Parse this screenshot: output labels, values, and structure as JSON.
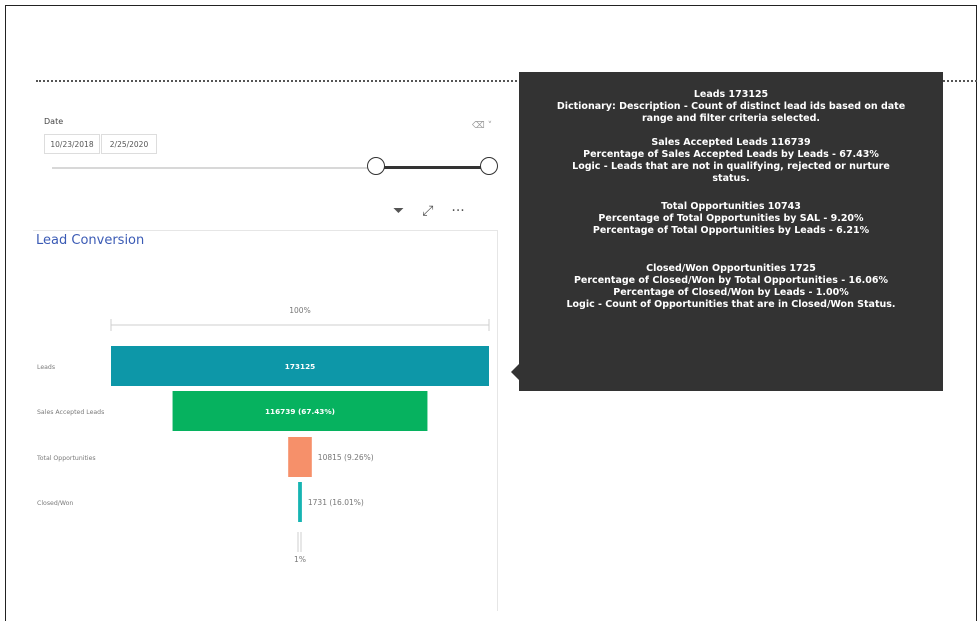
{
  "filter": {
    "label": "Date",
    "start": "10/23/2018",
    "end": "2/25/2020"
  },
  "chart_data": {
    "type": "bar",
    "title": "Lead Conversion",
    "categories": [
      "Leads",
      "Sales Accepted Leads",
      "Total Opportunities",
      "Closed/Won"
    ],
    "values": [
      173125,
      116739,
      10815,
      1731
    ],
    "labels": [
      "173125",
      "116739 (67.43%)",
      "10815 (9.26%)",
      "1731 (16.01%)"
    ],
    "colors": [
      "#0d97a8",
      "#06b25f",
      "#f6906a",
      "#16b4b2"
    ],
    "top_percent": "100%",
    "bottom_percent": "1%"
  },
  "tooltip": {
    "leads_title": "Leads 173125",
    "leads_desc": "Dictionary: Description - Count of distinct lead ids based on date\nrange and filter criteria selected.",
    "sal_title": "Sales Accepted Leads 116739",
    "sal_pct": "Percentage of Sales Accepted Leads by Leads - 67.43%",
    "sal_logic": "Logic -  Leads that are not in qualifying, rejected or nurture\nstatus.",
    "opp_title": "Total Opportunities 10743",
    "opp_sal": "Percentage of Total Opportunities by SAL - 9.20%",
    "opp_leads": "Percentage of Total Opportunities by Leads - 6.21%",
    "won_title": "Closed/Won Opportunities 1725",
    "won_pct": "Percentage of Closed/Won by Total Opportunities - 16.06%",
    "won_leads": "Percentage of Closed/Won by Leads - 1.00%",
    "won_logic": "Logic -  Count of Opportunities that are in Closed/Won Status."
  }
}
